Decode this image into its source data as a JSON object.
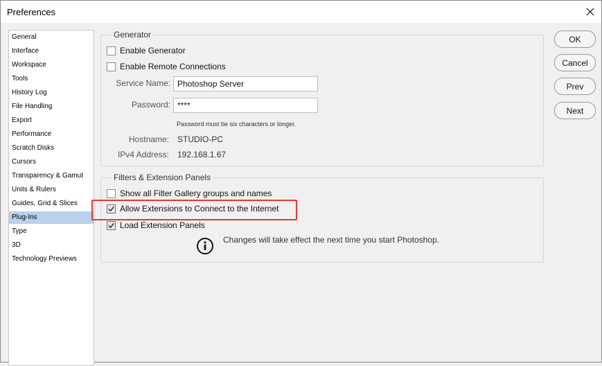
{
  "window": {
    "title": "Preferences"
  },
  "sidebar": {
    "items": [
      {
        "label": "General"
      },
      {
        "label": "Interface"
      },
      {
        "label": "Workspace"
      },
      {
        "label": "Tools"
      },
      {
        "label": "History Log"
      },
      {
        "label": "File Handling"
      },
      {
        "label": "Export"
      },
      {
        "label": "Performance"
      },
      {
        "label": "Scratch Disks"
      },
      {
        "label": "Cursors"
      },
      {
        "label": "Transparency & Gamut"
      },
      {
        "label": "Units & Rulers"
      },
      {
        "label": "Guides, Grid & Slices"
      },
      {
        "label": "Plug-Ins"
      },
      {
        "label": "Type"
      },
      {
        "label": "3D"
      },
      {
        "label": "Technology Previews"
      }
    ],
    "selected": "Plug-Ins"
  },
  "generator": {
    "title": "Generator",
    "enable_generator": {
      "label": "Enable Generator",
      "checked": false
    },
    "enable_remote": {
      "label": "Enable Remote Connections",
      "checked": false
    },
    "service_name": {
      "label": "Service Name:",
      "value": "Photoshop Server"
    },
    "password": {
      "label": "Password:",
      "value": "****",
      "hint": "Password must be six characters or longer."
    },
    "hostname": {
      "label": "Hostname:",
      "value": "STUDIO-PC"
    },
    "ipv4": {
      "label": "IPv4 Address:",
      "value": "192.168.1.67"
    }
  },
  "filters": {
    "title": "Filters & Extension Panels",
    "show_all": {
      "label": "Show all Filter Gallery groups and names",
      "checked": false
    },
    "allow_ext": {
      "label": "Allow Extensions to Connect to the Internet",
      "checked": true
    },
    "load_panels": {
      "label": "Load Extension Panels",
      "checked": true
    },
    "info": "Changes will take effect the next time you start Photoshop."
  },
  "buttons": {
    "ok": "OK",
    "cancel": "Cancel",
    "prev": "Prev",
    "next": "Next"
  },
  "colors": {
    "selected_bg": "#b9d1ea",
    "highlight": "#e0393b"
  }
}
